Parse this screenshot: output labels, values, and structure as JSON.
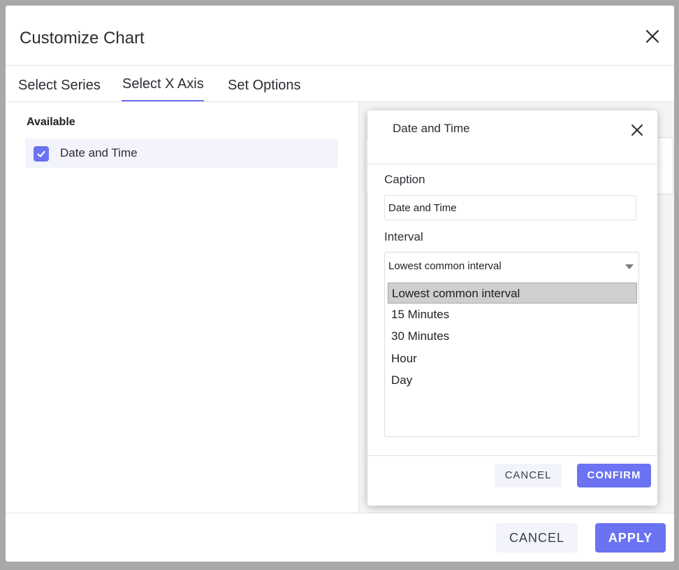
{
  "dialog": {
    "title": "Customize Chart",
    "tabs": [
      {
        "label": "Select Series"
      },
      {
        "label": "Select X Axis"
      },
      {
        "label": "Set Options"
      }
    ],
    "available_label": "Available",
    "available_items": [
      {
        "label": "Date and Time",
        "checked": true
      }
    ],
    "cancel_label": "CANCEL",
    "apply_label": "APPLY"
  },
  "popup": {
    "title": "Date and Time",
    "caption_label": "Caption",
    "caption_value": "Date and Time",
    "interval_label": "Interval",
    "interval_selected": "Lowest common interval",
    "interval_options": [
      "Lowest common interval",
      "15 Minutes",
      "30 Minutes",
      "Hour",
      "Day"
    ],
    "cancel_label": "CANCEL",
    "confirm_label": "CONFIRM"
  },
  "colors": {
    "accent": "#6b73f2",
    "backdrop": "#a8a8a8",
    "selected_option": "#cfcfcf"
  },
  "icons": {
    "close": "close-icon",
    "check": "checkmark-icon",
    "dropdown": "chevron-down-icon"
  }
}
